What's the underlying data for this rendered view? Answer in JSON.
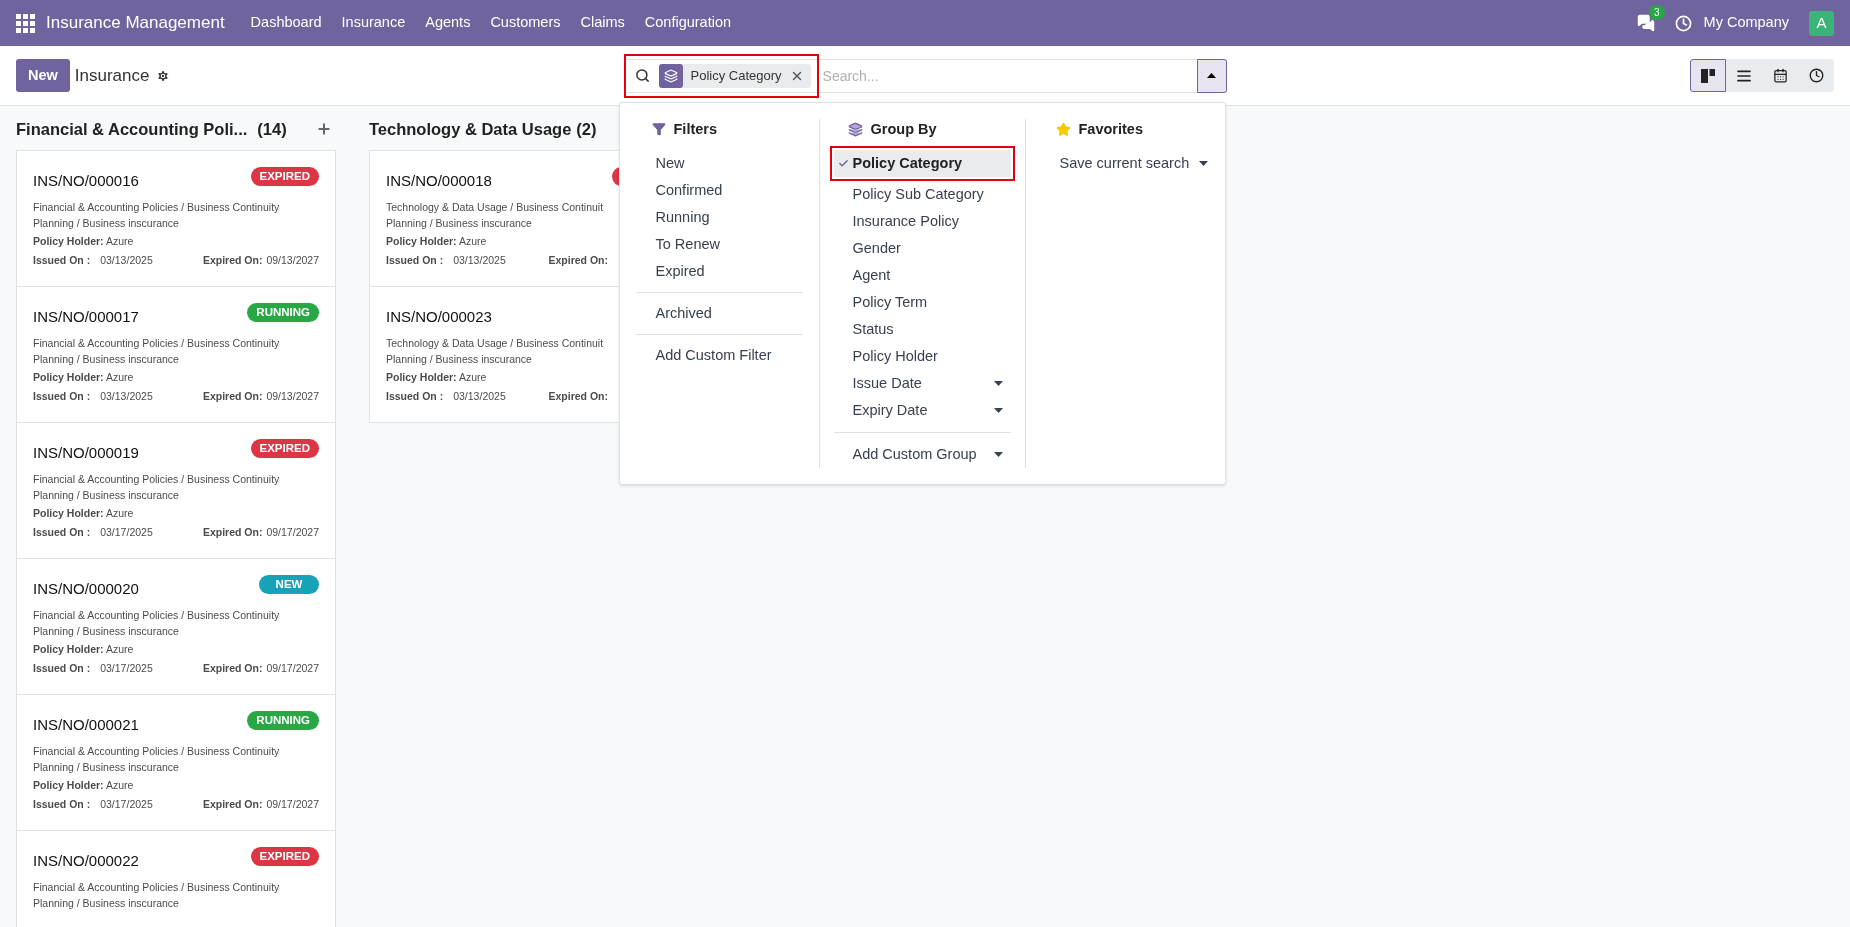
{
  "navbar": {
    "app_name": "Insurance Management",
    "menu": [
      "Dashboard",
      "Insurance",
      "Agents",
      "Customers",
      "Claims",
      "Configuration"
    ],
    "notification_count": "3",
    "company": "My Company",
    "avatar_letter": "A"
  },
  "control_panel": {
    "new_button": "New",
    "title": "Insurance",
    "search": {
      "facets": [
        {
          "label": "Policy Category",
          "highlighted": true
        }
      ],
      "placeholder": "Search...",
      "panel_open": true
    },
    "views": [
      {
        "kind": "kanban",
        "selected": true
      },
      {
        "kind": "list",
        "selected": false
      },
      {
        "kind": "calendar",
        "selected": false
      },
      {
        "kind": "activity",
        "selected": false
      }
    ]
  },
  "search_panel": {
    "filters": {
      "title": "Filters",
      "groups": [
        [
          "New",
          "Confirmed",
          "Running",
          "To Renew",
          "Expired"
        ],
        [
          "Archived"
        ],
        [
          "Add Custom Filter"
        ]
      ]
    },
    "group_by": {
      "title": "Group By",
      "items": [
        {
          "label": "Policy Category",
          "selected": true,
          "highlighted": true,
          "has_submenu": false
        },
        {
          "label": "Policy Sub Category",
          "selected": false,
          "highlighted": false,
          "has_submenu": false
        },
        {
          "label": "Insurance Policy",
          "selected": false,
          "highlighted": false,
          "has_submenu": false
        },
        {
          "label": "Gender",
          "selected": false,
          "highlighted": false,
          "has_submenu": false
        },
        {
          "label": "Agent",
          "selected": false,
          "highlighted": false,
          "has_submenu": false
        },
        {
          "label": "Policy Term",
          "selected": false,
          "highlighted": false,
          "has_submenu": false
        },
        {
          "label": "Status",
          "selected": false,
          "highlighted": false,
          "has_submenu": false
        },
        {
          "label": "Policy Holder",
          "selected": false,
          "highlighted": false,
          "has_submenu": false
        },
        {
          "label": "Issue Date",
          "selected": false,
          "highlighted": false,
          "has_submenu": true
        },
        {
          "label": "Expiry Date",
          "selected": false,
          "highlighted": false,
          "has_submenu": true
        }
      ],
      "custom_group": "Add Custom Group"
    },
    "favorites": {
      "title": "Favorites",
      "items": [
        {
          "label": "Save current search",
          "has_submenu": true
        }
      ]
    }
  },
  "columns": [
    {
      "title": "Financial & Accounting Poli...",
      "count": "(14)",
      "show_add": true,
      "cards": [
        {
          "reference": "INS/NO/000016",
          "color": "#dc3545",
          "badge": "EXPIRED",
          "description_lines": [
            "Financial & Accounting Policies / Business Continuity",
            "Planning / Business inscurance"
          ],
          "holder_label": "Policy Holder:",
          "holder": "Azure",
          "issued_label": "Issued On :",
          "issued_on": "03/13/2025",
          "expired_label": "Expired On:",
          "expired_on": "09/13/2027"
        },
        {
          "reference": "INS/NO/000017",
          "color": "#28a745",
          "badge": "RUNNING",
          "description_lines": [
            "Financial & Accounting Policies / Business Continuity",
            "Planning / Business inscurance"
          ],
          "holder_label": "Policy Holder:",
          "holder": "Azure",
          "issued_label": "Issued On :",
          "issued_on": "03/13/2025",
          "expired_label": "Expired On:",
          "expired_on": "09/13/2027"
        },
        {
          "reference": "INS/NO/000019",
          "color": "#dc3545",
          "badge": "EXPIRED",
          "description_lines": [
            "Financial & Accounting Policies / Business Continuity",
            "Planning / Business inscurance"
          ],
          "holder_label": "Policy Holder:",
          "holder": "Azure",
          "issued_label": "Issued On :",
          "issued_on": "03/17/2025",
          "expired_label": "Expired On:",
          "expired_on": "09/17/2027"
        },
        {
          "reference": "INS/NO/000020",
          "color": "#17a2b8",
          "badge": "NEW",
          "description_lines": [
            "Financial & Accounting Policies / Business Continuity",
            "Planning / Business inscurance"
          ],
          "holder_label": "Policy Holder:",
          "holder": "Azure",
          "issued_label": "Issued On :",
          "issued_on": "03/17/2025",
          "expired_label": "Expired On:",
          "expired_on": "09/17/2027"
        },
        {
          "reference": "INS/NO/000021",
          "color": "#28a745",
          "badge": "RUNNING",
          "description_lines": [
            "Financial & Accounting Policies / Business Continuity",
            "Planning / Business inscurance"
          ],
          "holder_label": "Policy Holder:",
          "holder": "Azure",
          "issued_label": "Issued On :",
          "issued_on": "03/17/2025",
          "expired_label": "Expired On:",
          "expired_on": "09/17/2027"
        },
        {
          "reference": "INS/NO/000022",
          "color": "#dc3545",
          "badge": "EXPIRED",
          "description_lines": [
            "Financial & Accounting Policies / Business Continuity",
            "Planning / Business inscurance"
          ]
        }
      ]
    },
    {
      "title": "Technology & Data Usage",
      "count": "(2)",
      "show_add": false,
      "cards": [
        {
          "reference": "INS/NO/000018",
          "color": "#dc3545",
          "description_lines": [
            "Technology & Data Usage / Business Continuit",
            "Planning / Business inscurance"
          ],
          "holder_label": "Policy Holder:",
          "holder": "Azure",
          "issued_label": "Issued On :",
          "issued_on": "03/13/2025",
          "expired_label": "Expired On:"
        },
        {
          "reference": "INS/NO/000023",
          "description_lines": [
            "Technology & Data Usage / Business Continuit",
            "Planning / Business inscurance"
          ],
          "holder_label": "Policy Holder:",
          "holder": "Azure",
          "issued_label": "Issued On :",
          "issued_on": "03/13/2025",
          "expired_label": "Expired On:"
        }
      ]
    }
  ]
}
